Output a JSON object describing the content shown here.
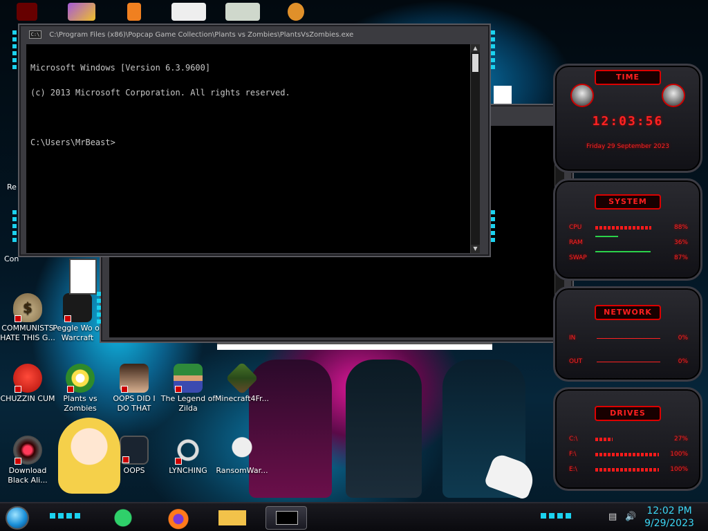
{
  "desktop": {
    "icons": [
      {
        "label": "COMMUNISTS HATE THIS G...",
        "icon": "money-bag-icon"
      },
      {
        "label": "Peggle Wo of Warcraft",
        "icon": "peggle-icon"
      },
      {
        "label": "CHUZZIN CUM",
        "icon": "chuzzle-icon"
      },
      {
        "label": "Plants vs Zombies",
        "icon": "plants-vs-zombies-icon"
      },
      {
        "label": "OOPS DID I DO THAT",
        "icon": "portrait-icon"
      },
      {
        "label": "The Legend of Zilda",
        "icon": "zelda-icon"
      },
      {
        "label": "Minecraft4Fr...",
        "icon": "minecraft-icon"
      },
      {
        "label": "Download Black Ali...",
        "icon": "alienware-icon"
      },
      {
        "label": "OOPS",
        "icon": "computer-icon"
      },
      {
        "label": "LYNCHING",
        "icon": "knot-icon"
      },
      {
        "label": "RansomWar...",
        "icon": "skull-icon"
      }
    ],
    "partial_labels": {
      "re": "Re",
      "con": "Con"
    }
  },
  "console_front": {
    "title": "C:\\Program Files (x86)\\Popcap Game Collection\\Plants vs Zombies\\PlantsVsZombies.exe",
    "sys_icon": "C:\\",
    "lines": [
      "Microsoft Windows [Version 6.3.9600]",
      "(c) 2013 Microsoft Corporation. All rights reserved.",
      "",
      "C:\\Users\\MrBeast>"
    ]
  },
  "console_back": {
    "title": ""
  },
  "gadgets": {
    "time": {
      "header": "TIME",
      "clock": "12:03:56",
      "date": "Friday 29 September 2023"
    },
    "system": {
      "header": "SYSTEM",
      "rows": [
        {
          "label": "CPU",
          "value": "88%",
          "fill": 0.88
        },
        {
          "label": "RAM",
          "value": "36%",
          "fill": 0.36
        },
        {
          "label": "SWAP",
          "value": "87%",
          "fill": 0.87
        }
      ]
    },
    "network": {
      "header": "NETWORK",
      "rows": [
        {
          "label": "IN",
          "value": "0%"
        },
        {
          "label": "OUT",
          "value": "0%"
        }
      ]
    },
    "drives": {
      "header": "DRIVES",
      "rows": [
        {
          "label": "C:\\",
          "value": "27%",
          "fill": 0.27
        },
        {
          "label": "F:\\",
          "value": "100%",
          "fill": 1.0
        },
        {
          "label": "E:\\",
          "value": "100%",
          "fill": 1.0
        }
      ]
    }
  },
  "taskbar": {
    "pinned": [
      "notes-app-icon",
      "firefox-icon",
      "file-explorer-icon",
      "command-prompt-icon"
    ],
    "clock_time": "12:02 PM",
    "clock_date": "9/29/2023"
  },
  "colors": {
    "accent_cyan": "#1bd2ef",
    "gadget_red": "#ff2222",
    "console_bg": "#000000"
  }
}
